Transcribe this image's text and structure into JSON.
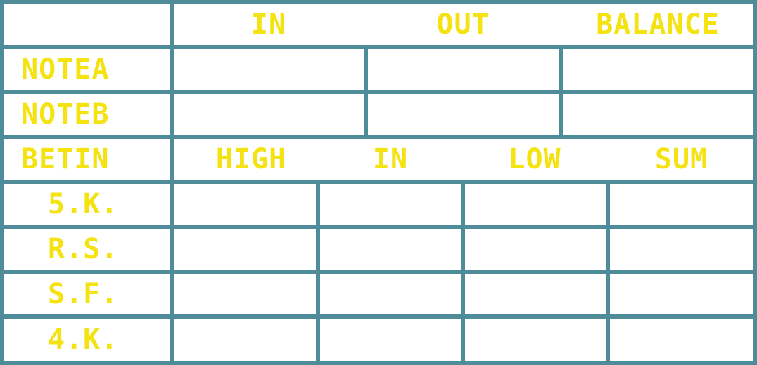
{
  "header": {
    "in": "IN",
    "out": "OUT",
    "balance": "BALANCE"
  },
  "rows": {
    "note_a": "NOTEA",
    "note_b": "NOTEB"
  },
  "bet_header": {
    "label": "BETIN",
    "high": "HIGH",
    "in": "IN",
    "low": "LOW",
    "sum": "SUM"
  },
  "bet_rows": [
    "5.K.",
    "R.S.",
    "S.F.",
    "4.K."
  ],
  "colors": {
    "grid": "#4f8c99",
    "cell": "#ffffff",
    "text": "#f4e211"
  }
}
